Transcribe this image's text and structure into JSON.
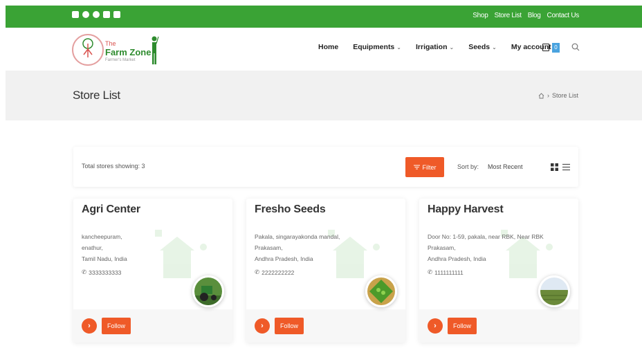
{
  "colors": {
    "brand_green": "#3aa335",
    "accent_orange": "#ef5a28",
    "cart_badge": "#4aa3df"
  },
  "topbar": {
    "social_icons": [
      "twitter-icon",
      "facebook-icon",
      "instagram-icon",
      "linkedin-icon",
      "youtube-icon"
    ],
    "links": [
      "Shop",
      "Store List",
      "Blog",
      "Contact Us"
    ]
  },
  "logo": {
    "line1": "The",
    "line2": "Farm Zone",
    "line3": "Farmer's Market"
  },
  "nav": {
    "items": [
      {
        "label": "Home",
        "has_dropdown": false
      },
      {
        "label": "Equipments",
        "has_dropdown": true
      },
      {
        "label": "Irrigation",
        "has_dropdown": true
      },
      {
        "label": "Seeds",
        "has_dropdown": true
      },
      {
        "label": "My account",
        "has_dropdown": false
      }
    ],
    "cart_count": "0"
  },
  "banner": {
    "title": "Store List",
    "breadcrumb": "Store List"
  },
  "filterbar": {
    "total_text": "Total stores showing: 3",
    "filter_label": "Filter",
    "sort_label": "Sort by:",
    "sort_value": "Most Recent"
  },
  "stores": [
    {
      "name": "Agri Center",
      "address": [
        "kancheepuram,",
        "enathur,",
        "Tamil Nadu, India"
      ],
      "phone": "3333333333",
      "follow": "Follow",
      "image": "tractor"
    },
    {
      "name": "Fresho Seeds",
      "address": [
        "Pakala, singarayakonda mandal,",
        "Prakasam,",
        "Andhra Pradesh, India"
      ],
      "phone": "2222222222",
      "follow": "Follow",
      "image": "seeds"
    },
    {
      "name": "Happy Harvest",
      "address": [
        "Door No: 1-59, pakala, near RBK, Near RBK",
        "Prakasam,",
        "Andhra Pradesh, India"
      ],
      "phone": "1111111111",
      "follow": "Follow",
      "image": "field"
    }
  ]
}
